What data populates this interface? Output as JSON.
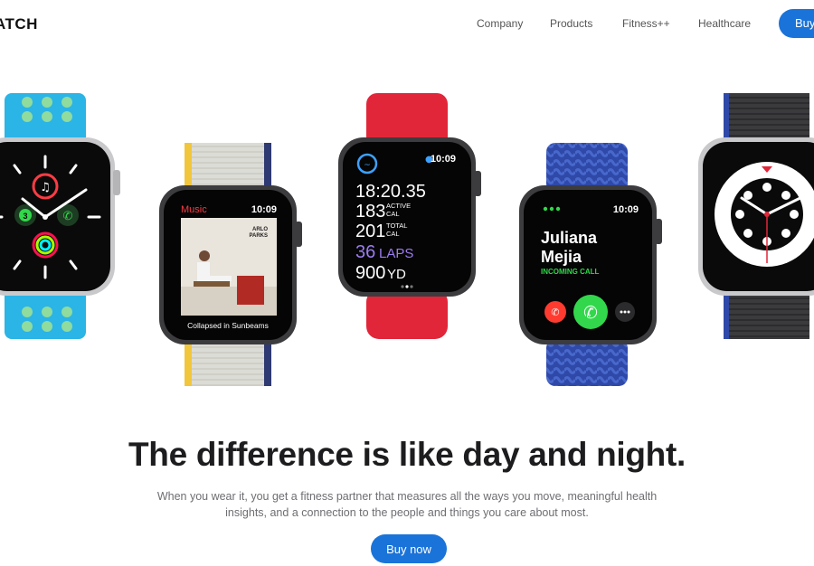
{
  "brand": {
    "logo_text": "ATCH"
  },
  "nav": {
    "links": [
      "Company",
      "Products",
      "Fitness++",
      "Healthcare"
    ],
    "buy_label": "Buy"
  },
  "watches": {
    "music": {
      "app": "Music",
      "time": "10:09",
      "album_line1": "ARLO",
      "album_line2": "PARKS",
      "track": "Collapsed in Sunbeams"
    },
    "workout": {
      "time": "10:09",
      "elapsed": "18:20.35",
      "active_cal_value": "183",
      "active_cal_l1": "ACTIVE",
      "active_cal_l2": "CAL",
      "total_cal_value": "201",
      "total_cal_l1": "TOTAL",
      "total_cal_l2": "CAL",
      "laps_value": "36",
      "laps_unit": "LAPS",
      "distance_value": "900",
      "distance_unit": "YD"
    },
    "call": {
      "time": "10:09",
      "first_name": "Juliana",
      "last_name": "Mejia",
      "status": "INCOMING CALL"
    },
    "activity": {
      "messages_badge": "3"
    },
    "colors": {
      "accent": "#1a73d9",
      "call_green": "#32d74b",
      "decline_red": "#ff3b30",
      "laps_purple": "#9b7cf0",
      "music_red": "#fa3c44"
    }
  },
  "hero": {
    "headline": "The difference is like day and night.",
    "subtitle": "When you wear it, you get a fitness partner that measures all the ways you move, meaningful health insights, and a connection to the people and things you care about most.",
    "cta_label": "Buy now"
  }
}
